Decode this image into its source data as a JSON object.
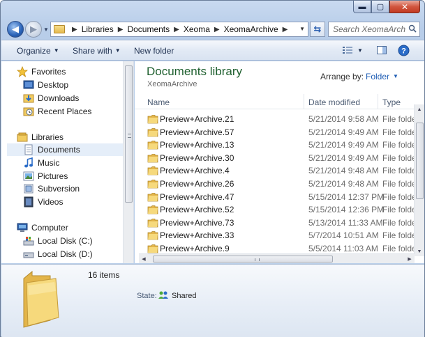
{
  "window": {
    "minimize_glyph": "▬",
    "maximize_glyph": "▢",
    "close_glyph": "✕"
  },
  "address": {
    "crumbs": [
      "Libraries",
      "Documents",
      "Xeoma",
      "XeomaArchive"
    ],
    "search_placeholder": "Search XeomaArchi..."
  },
  "toolbar": {
    "organize_label": "Organize",
    "share_label": "Share with",
    "new_folder_label": "New folder"
  },
  "nav": {
    "favorites_label": "Favorites",
    "desktop_label": "Desktop",
    "downloads_label": "Downloads",
    "recent_label": "Recent Places",
    "libraries_label": "Libraries",
    "documents_label": "Documents",
    "music_label": "Music",
    "pictures_label": "Pictures",
    "subversion_label": "Subversion",
    "videos_label": "Videos",
    "computer_label": "Computer",
    "local_c_label": "Local Disk (C:)",
    "local_d_label": "Local Disk (D:)"
  },
  "library": {
    "title": "Documents library",
    "subtitle": "XeomaArchive",
    "arrange_label": "Arrange by:",
    "arrange_value": "Folder"
  },
  "columns": {
    "name": "Name",
    "date": "Date modified",
    "type": "Type"
  },
  "files": [
    {
      "name": "Preview+Archive.21",
      "date": "5/21/2014 9:58 AM",
      "type": "File folder"
    },
    {
      "name": "Preview+Archive.57",
      "date": "5/21/2014 9:49 AM",
      "type": "File folder"
    },
    {
      "name": "Preview+Archive.13",
      "date": "5/21/2014 9:49 AM",
      "type": "File folder"
    },
    {
      "name": "Preview+Archive.30",
      "date": "5/21/2014 9:49 AM",
      "type": "File folder"
    },
    {
      "name": "Preview+Archive.4",
      "date": "5/21/2014 9:48 AM",
      "type": "File folder"
    },
    {
      "name": "Preview+Archive.26",
      "date": "5/21/2014 9:48 AM",
      "type": "File folder"
    },
    {
      "name": "Preview+Archive.47",
      "date": "5/15/2014 12:37 PM",
      "type": "File folder"
    },
    {
      "name": "Preview+Archive.52",
      "date": "5/15/2014 12:36 PM",
      "type": "File folder"
    },
    {
      "name": "Preview+Archive.73",
      "date": "5/13/2014 11:33 AM",
      "type": "File folder"
    },
    {
      "name": "Preview+Archive.33",
      "date": "5/7/2014 10:51 AM",
      "type": "File folder"
    },
    {
      "name": "Preview+Archive.9",
      "date": "5/5/2014 11:03 AM",
      "type": "File folder"
    }
  ],
  "details": {
    "count": "16 items",
    "state_label": "State:",
    "state_value": "Shared"
  },
  "colors": {
    "accent_blue": "#1f5eb5",
    "title_green": "#1e5f2e",
    "folder_yellow": "#f2cc60"
  }
}
